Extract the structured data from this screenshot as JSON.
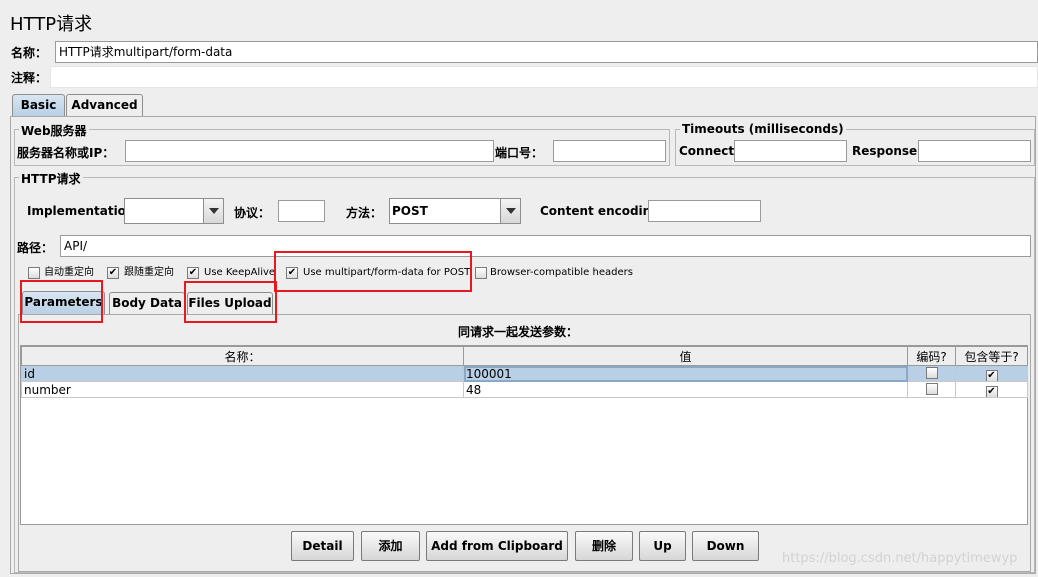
{
  "page_title": "HTTP请求",
  "name_label": "名称：",
  "name_value": "HTTP请求multipart/form-data",
  "comment_label": "注释：",
  "comment_value": "",
  "tabs": [
    "Basic",
    "Advanced"
  ],
  "web_server": {
    "legend": "Web服务器",
    "server_label": "服务器名称或IP：",
    "server_value": "",
    "port_label": "端口号：",
    "port_value": ""
  },
  "timeouts": {
    "legend": "Timeouts (milliseconds)",
    "connect_label": "Connect:",
    "connect_value": "",
    "response_label": "Response:",
    "response_value": ""
  },
  "http_request": {
    "legend": "HTTP请求",
    "implementation_label": "Implementation:",
    "implementation_value": "",
    "protocol_label": "协议：",
    "protocol_value": "",
    "method_label": "方法：",
    "method_value": "POST",
    "encoding_label": "Content encoding:",
    "encoding_value": "",
    "path_label": "路径：",
    "path_value": "API/"
  },
  "checkboxes": [
    {
      "label": "自动重定向",
      "checked": false
    },
    {
      "label": "跟随重定向",
      "checked": true
    },
    {
      "label": "Use KeepAlive",
      "checked": true
    },
    {
      "label": "Use multipart/form-data for POST",
      "checked": true
    },
    {
      "label": "Browser-compatible headers",
      "checked": false
    }
  ],
  "sub_tabs": [
    "Parameters",
    "Body Data",
    "Files Upload"
  ],
  "params_caption": "同请求一起发送参数：",
  "table": {
    "headers": [
      "名称：",
      "值",
      "编码?",
      "包含等于?"
    ],
    "rows": [
      {
        "name": "id",
        "value": "100001",
        "encode": false,
        "include_equals": true
      },
      {
        "name": "number",
        "value": "48",
        "encode": false,
        "include_equals": true
      }
    ]
  },
  "buttons": [
    "Detail",
    "添加",
    "Add from Clipboard",
    "删除",
    "Up",
    "Down"
  ],
  "watermark": "https://blog.csdn.net/happytimewyp",
  "colors": {
    "highlight_box": "#e8191e",
    "selected_tab": "#b8cfe5"
  }
}
